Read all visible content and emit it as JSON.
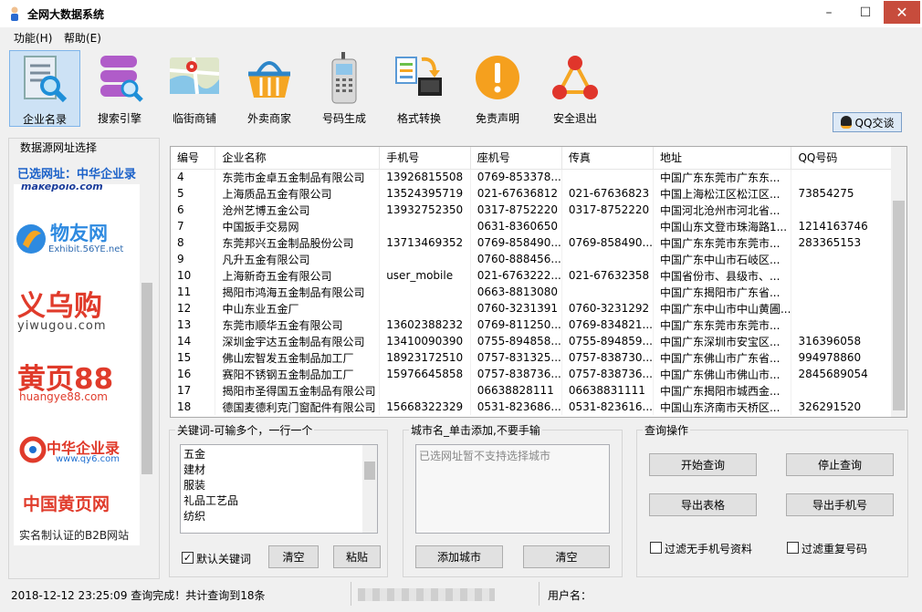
{
  "window": {
    "title": "全网大数据系统",
    "min": "–",
    "max": "☐",
    "close": "✕"
  },
  "menu": [
    {
      "label": "功能(H)"
    },
    {
      "label": "帮助(E)"
    }
  ],
  "toolbar": [
    {
      "label": "企业名录",
      "icon": "search-document-icon"
    },
    {
      "label": "搜索引擎",
      "icon": "database-search-icon"
    },
    {
      "label": "临街商铺",
      "icon": "map-icon"
    },
    {
      "label": "外卖商家",
      "icon": "basket-icon"
    },
    {
      "label": "号码生成",
      "icon": "phone-icon"
    },
    {
      "label": "格式转换",
      "icon": "convert-icon"
    },
    {
      "label": "免责声明",
      "icon": "warning-icon"
    },
    {
      "label": "安全退出",
      "icon": "exit-icon"
    }
  ],
  "qq_button": "QQ交谈",
  "left": {
    "title": "数据源网址选择",
    "selected": "已选网址：中华企业录",
    "logos": [
      "makepolo.com",
      "物友网",
      "Exhibit.56YE.net",
      "义乌购",
      "yiwugou.com",
      "黄页88",
      "huangye88.com",
      "中华企业录",
      "www.qy6.com",
      "中国黄页网"
    ],
    "footer": "实名制认证的B2B网站"
  },
  "table": {
    "headers": [
      "编号",
      "企业名称",
      "手机号",
      "座机号",
      "传真",
      "地址",
      "QQ号码"
    ],
    "rows": [
      [
        "4",
        "东莞市金卓五金制品有限公司",
        "13926815508",
        "0769-853378...",
        "",
        "中国广东东莞市广东东...",
        ""
      ],
      [
        "5",
        "上海质品五金有限公司",
        "13524395719",
        "021-67636812",
        "021-67636823",
        "中国上海松江区松江区...",
        "73854275"
      ],
      [
        "6",
        "沧州艺博五金公司",
        "13932752350",
        "0317-8752220",
        "0317-8752220",
        "中国河北沧州市河北省...",
        ""
      ],
      [
        "7",
        "中国扳手交易网",
        "",
        "0631-8360650",
        "",
        "中国山东文登市珠海路1...",
        "1214163746"
      ],
      [
        "8",
        "东莞邦兴五金制品股份公司",
        "13713469352",
        "0769-858490...",
        "0769-858490...",
        "中国广东东莞市东莞市...",
        "283365153"
      ],
      [
        "9",
        "凡升五金有限公司",
        "",
        "0760-888456...",
        "",
        "中国广东中山市石岐区...",
        ""
      ],
      [
        "10",
        "上海新奇五金有限公司",
        "user_mobile",
        "021-6763222...",
        "021-67632358",
        "中国省份市、县级市、...",
        ""
      ],
      [
        "11",
        "揭阳市鸿海五金制品有限公司",
        "",
        "0663-8813080",
        "",
        "中国广东揭阳市广东省...",
        ""
      ],
      [
        "12",
        "中山东业五金厂",
        "",
        "0760-3231391",
        "0760-3231292",
        "中国广东中山市中山黄圃...",
        ""
      ],
      [
        "13",
        "东莞市顺华五金有限公司",
        "13602388232",
        "0769-811250...",
        "0769-834821...",
        "中国广东东莞市东莞市...",
        ""
      ],
      [
        "14",
        "深圳金宇达五金制品有限公司",
        "13410090390",
        "0755-894858...",
        "0755-894859...",
        "中国广东深圳市安宝区...",
        "316396058"
      ],
      [
        "15",
        "佛山宏智发五金制品加工厂",
        "18923172510",
        "0757-831325...",
        "0757-838730...",
        "中国广东佛山市广东省...",
        "994978860"
      ],
      [
        "16",
        "赛阳不锈钢五金制品加工厂",
        "15976645858",
        "0757-838736...",
        "0757-838736...",
        "中国广东佛山市佛山市...",
        "2845689054"
      ],
      [
        "17",
        "揭阳市圣得国五金制品有限公司",
        "",
        "06638828111",
        "06638831111",
        "中国广东揭阳市城西金...",
        ""
      ],
      [
        "18",
        "德国麦德利克门窗配件有限公司",
        "15668322329",
        "0531-823686...",
        "0531-823616...",
        "中国山东济南市天桥区...",
        "326291520"
      ]
    ]
  },
  "keywords": {
    "title": "关键词-可输多个，一行一个",
    "items": [
      "五金",
      "建材",
      "服装",
      "礼品工艺品",
      "纺织"
    ],
    "default_label": "默认关键词",
    "default_checked": true,
    "clear": "清空",
    "paste": "粘贴"
  },
  "city": {
    "title": "城市名_单击添加,不要手输",
    "placeholder": "已选网址暂不支持选择城市",
    "add": "添加城市",
    "clear": "清空"
  },
  "query": {
    "title": "查询操作",
    "start": "开始查询",
    "stop": "停止查询",
    "export_table": "导出表格",
    "export_phone": "导出手机号",
    "filter_no_phone": "过滤无手机号资料",
    "filter_dup": "过滤重复号码"
  },
  "status": {
    "message": "2018-12-12 23:25:09 查询完成！共计查询到18条",
    "user_label": "用户名："
  }
}
